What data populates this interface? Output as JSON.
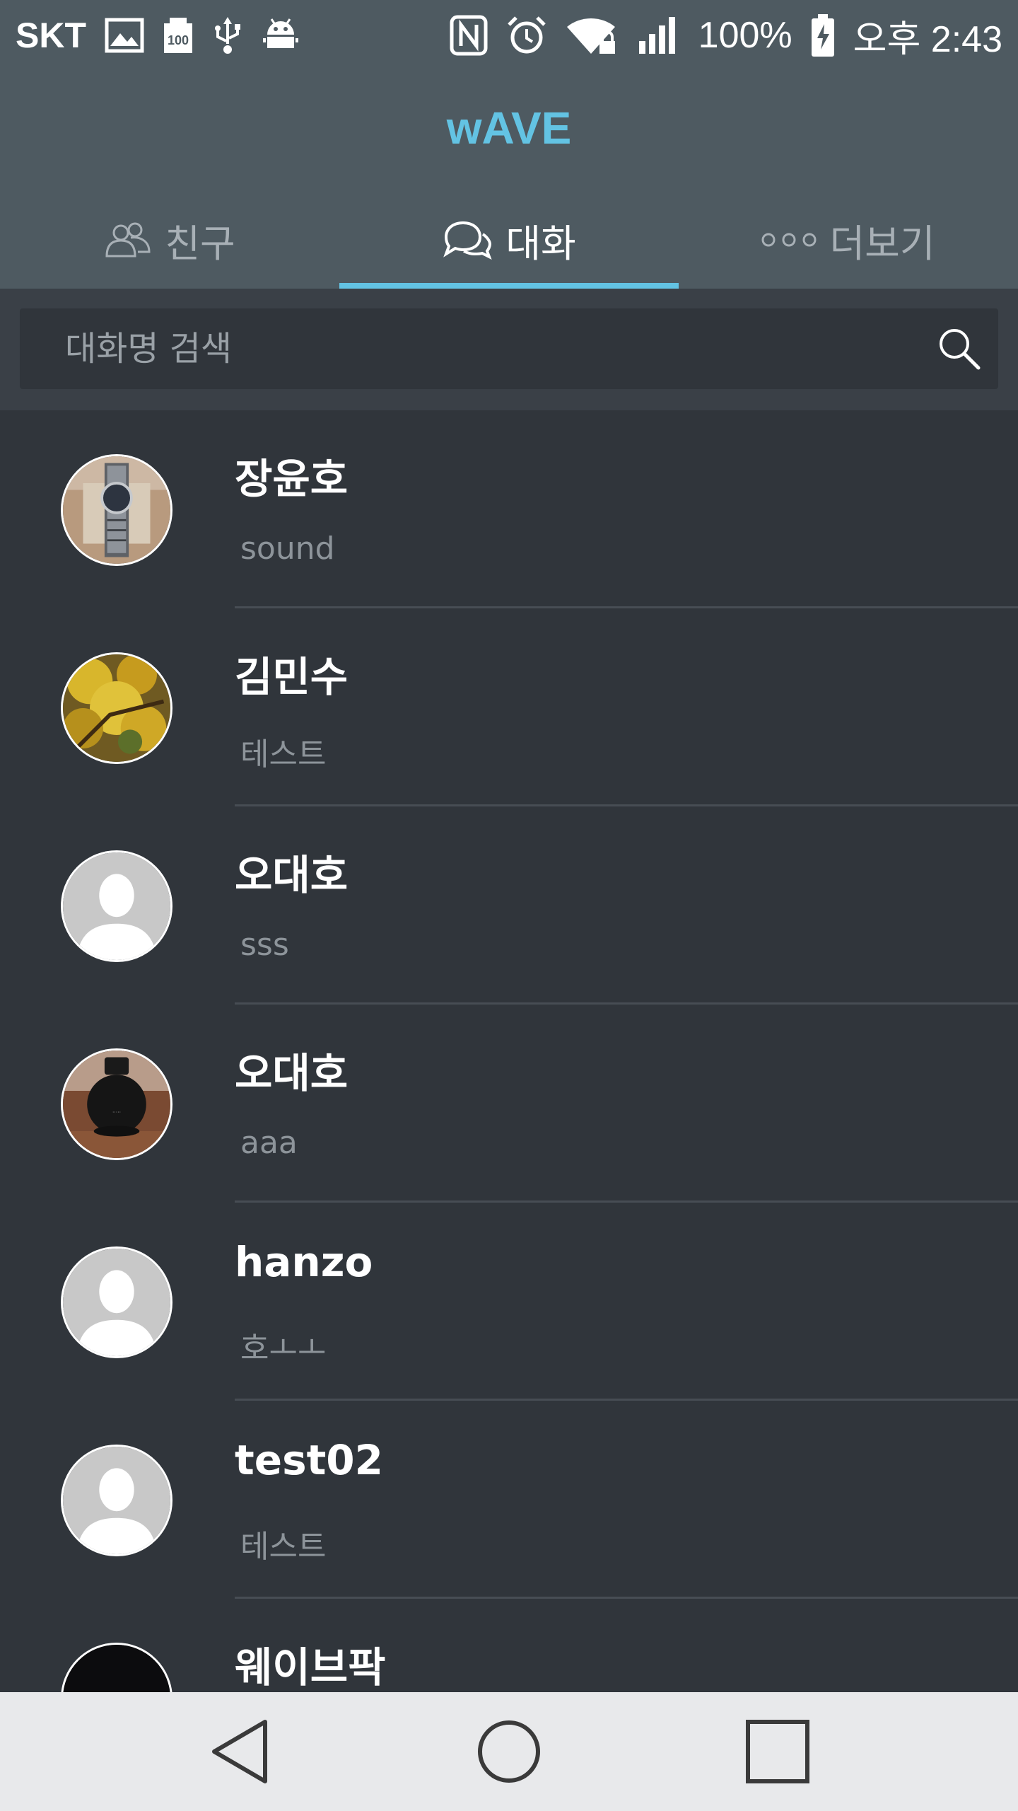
{
  "status_bar": {
    "carrier": "SKT",
    "battery": "100%",
    "time": "오후 2:43",
    "icons": [
      "gallery-icon",
      "sd-100-icon",
      "usb-icon",
      "android-debug-icon",
      "nfc-icon",
      "alarm-icon",
      "wifi-lock-icon",
      "signal-icon",
      "battery-charging-icon"
    ]
  },
  "app": {
    "title": "wAVE"
  },
  "tabs": [
    {
      "label": "친구",
      "icon": "friends-icon",
      "active": false
    },
    {
      "label": "대화",
      "icon": "chat-bubbles-icon",
      "active": true
    },
    {
      "label": "더보기",
      "icon": "more-dots-icon",
      "active": false
    }
  ],
  "search": {
    "placeholder": "대화명 검색",
    "value": ""
  },
  "conversations": [
    {
      "name": "장윤호",
      "preview": "sound",
      "avatar": "watch-photo"
    },
    {
      "name": "김민수",
      "preview": "테스트",
      "avatar": "autumn-tree-photo"
    },
    {
      "name": "오대호",
      "preview": "sss",
      "avatar": "default-person"
    },
    {
      "name": "오대호",
      "preview": "aaa",
      "avatar": "black-bottle-photo"
    },
    {
      "name": "hanzo",
      "preview": "호ㅗㅗ",
      "avatar": "default-person"
    },
    {
      "name": "test02",
      "preview": "테스트",
      "avatar": "default-person"
    },
    {
      "name": "웨이브팍",
      "preview": "",
      "avatar": "black-photo"
    }
  ],
  "colors": {
    "accent": "#63c3e3",
    "header_bg": "#4e5a61",
    "list_bg": "#30353b",
    "nav_bg": "#e8e9eb"
  },
  "nav": {
    "buttons": [
      "back-icon",
      "home-icon",
      "recents-icon"
    ]
  }
}
